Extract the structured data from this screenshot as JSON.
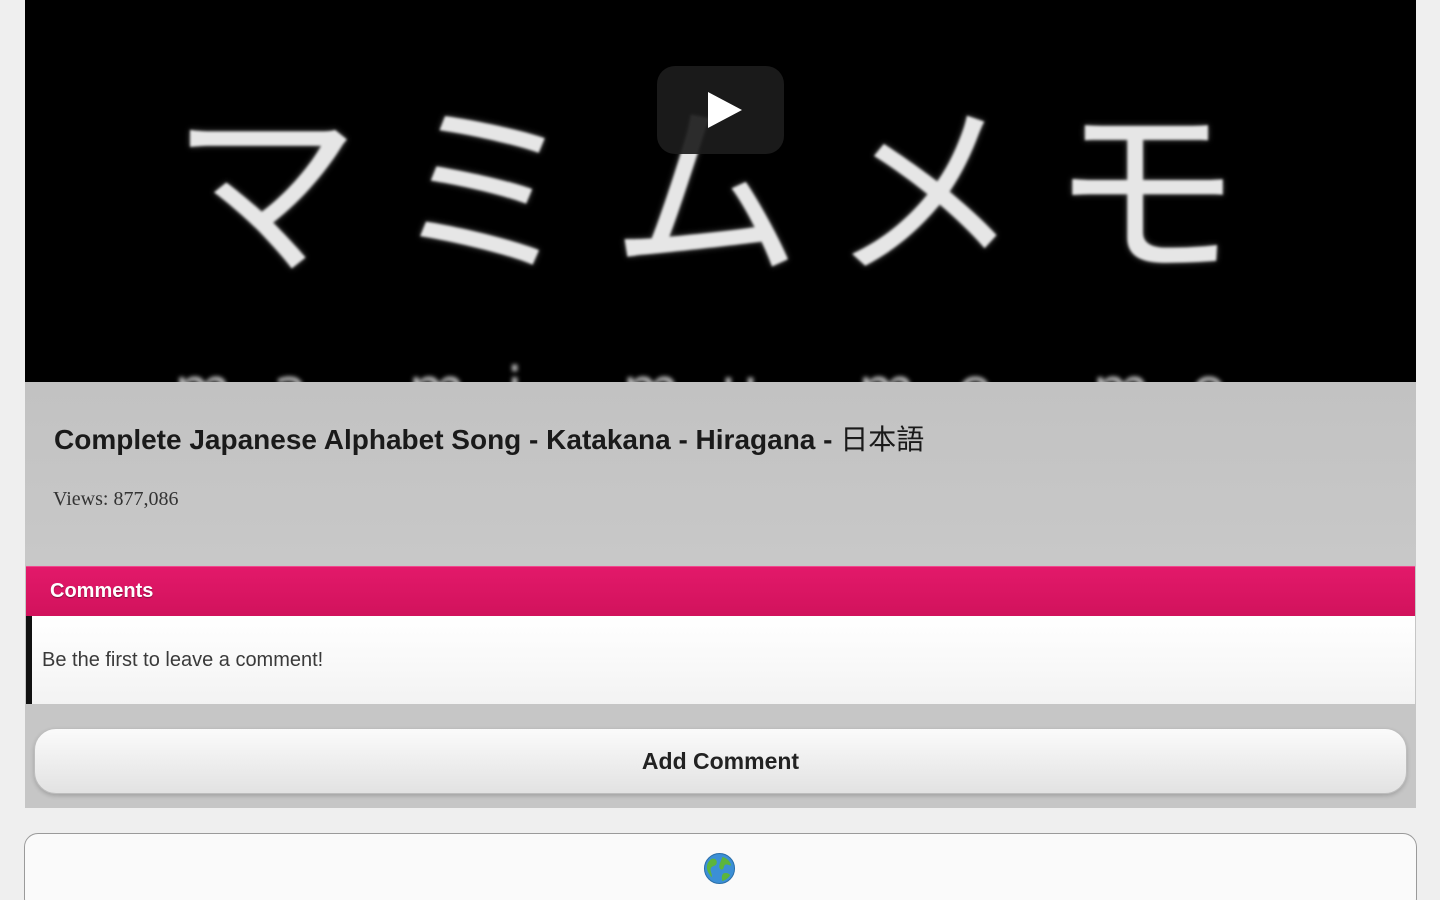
{
  "video": {
    "overlay_text": "マミムメモ",
    "overlay_subtext": "ma mi mu me mo",
    "title": "Complete Japanese Alphabet Song - Katakana - Hiragana - ",
    "title_cjk": "日本語",
    "views": "Views: 877,086"
  },
  "comments": {
    "header": "Comments",
    "empty_message": "Be the first to leave a comment!",
    "add_button_label": "Add Comment"
  },
  "footer": {
    "icon": "globe-icon"
  },
  "colors": {
    "accent": "#e3196a",
    "panel": "#c6c6c6",
    "video_bg": "#000000"
  }
}
